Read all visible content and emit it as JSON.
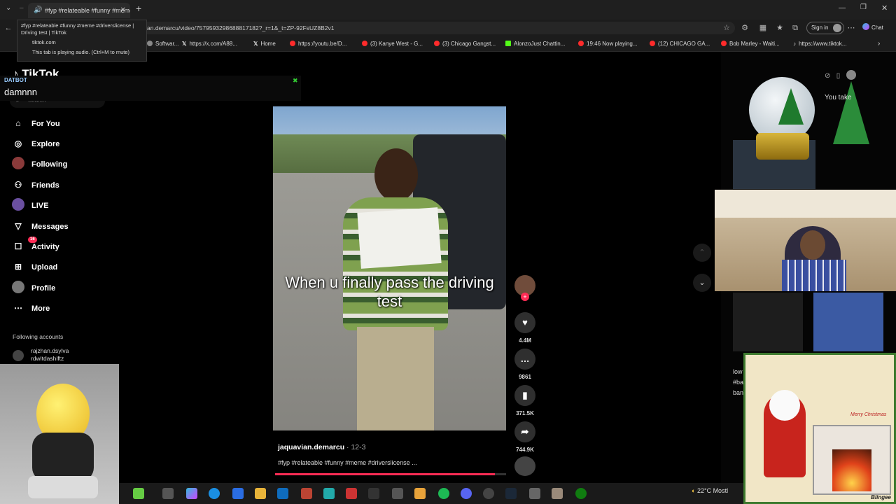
{
  "browser": {
    "tab_title": "#fyp #relateable #funny #meme",
    "tab_new": "+",
    "url": "an.demarcu/video/7579593298688817182?_r=1&_t=ZP-92FsUZ8B2v1",
    "signin_label": "Sign in",
    "chat_label": "Chat",
    "tooltip": {
      "title": "#fyp #relateable #funny #meme #driverslicense | Driving test | TikTok",
      "domain": "tiktok.com",
      "audio_note": "This tab is playing audio. (Ctrl+M to mute)"
    },
    "bookmarks": [
      {
        "label": "Softwar...",
        "color": "#888"
      },
      {
        "label": "https://x.com/A88...",
        "color": "#fff"
      },
      {
        "label": "Home",
        "color": "#fff"
      },
      {
        "label": "https://youtu.be/D...",
        "color": "#ff2b2b"
      },
      {
        "label": "(3) Kanye West - G...",
        "color": "#ff2b2b"
      },
      {
        "label": "(3) Chicago Gangst...",
        "color": "#ff2b2b"
      },
      {
        "label": "AlonzoJust Chattin...",
        "color": "#53fc18"
      },
      {
        "label": "19:46 Now playing...",
        "color": "#ff2b2b"
      },
      {
        "label": "(12) CHICAGO GA...",
        "color": "#ff2b2b"
      },
      {
        "label": "Bob Marley - Waiti...",
        "color": "#ff2b2b"
      },
      {
        "label": "https://www.tiktok...",
        "color": "#fff"
      }
    ]
  },
  "tiktok": {
    "logo": "TikTok",
    "search_placeholder": "Search",
    "nav": [
      {
        "label": "For You",
        "icon": "home-icon"
      },
      {
        "label": "Explore",
        "icon": "compass-icon"
      },
      {
        "label": "Following",
        "icon": "following-avatar-icon"
      },
      {
        "label": "Friends",
        "icon": "friends-icon"
      },
      {
        "label": "LIVE",
        "icon": "live-avatar-icon"
      },
      {
        "label": "Messages",
        "icon": "messages-icon"
      },
      {
        "label": "Activity",
        "icon": "activity-icon",
        "badge": "16"
      },
      {
        "label": "Upload",
        "icon": "upload-icon"
      },
      {
        "label": "Profile",
        "icon": "profile-avatar-icon"
      },
      {
        "label": "More",
        "icon": "more-icon"
      }
    ],
    "following_header": "Following accounts",
    "following_account": {
      "name": "rajzhan.dsylva",
      "handle": "rdwitdashiftz"
    },
    "video": {
      "caption": "When u finally pass the driving test",
      "author": "jaquavian.demarcu",
      "date": "12-3",
      "tags": "#fyp #relateable #funny #meme #driverslicense ...",
      "progress": 0.95
    },
    "stats": {
      "likes": "4.4M",
      "comments": "9861",
      "saves": "371.5K",
      "shares": "744.9K"
    }
  },
  "overlay": {
    "datbot_label": "DATBOT",
    "datbot_message": "damnnn",
    "you_take": "You take",
    "merry": "Merry Christmas",
    "blingee": "Blingee"
  },
  "system": {
    "weather": "22°C  Mostl"
  }
}
